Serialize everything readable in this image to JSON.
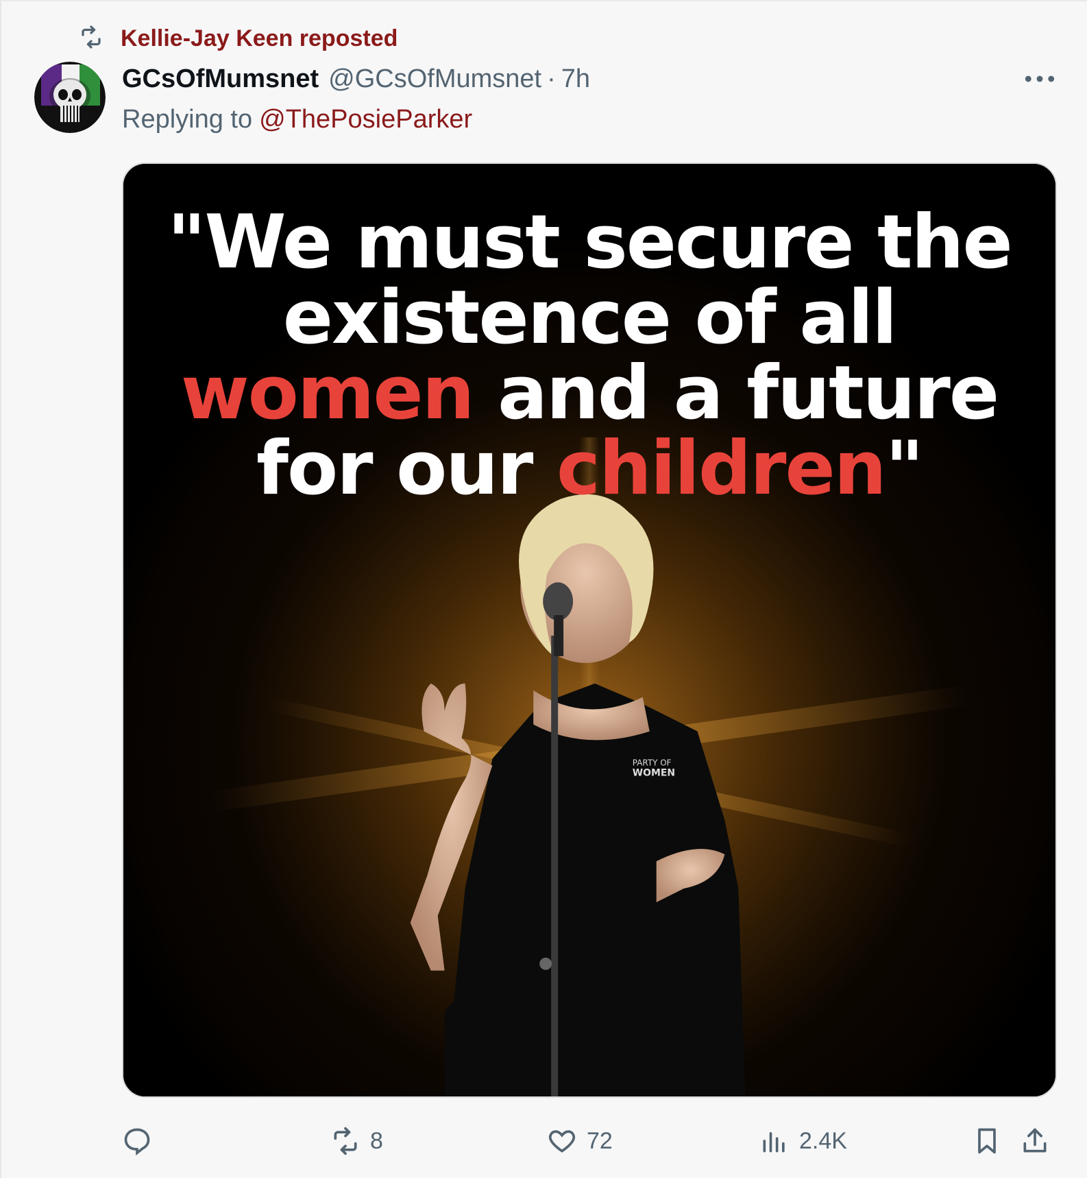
{
  "repost": {
    "label": "Kellie-Jay Keen reposted"
  },
  "author": {
    "display_name": "GCsOfMumsnet",
    "handle": "@GCsOfMumsnet",
    "separator": "·",
    "time": "7h"
  },
  "reply": {
    "prefix": "Replying to",
    "target": "@ThePosieParker"
  },
  "media": {
    "line1": "\"We must secure the",
    "line2": "existence of all",
    "line3_highlight": "women",
    "line3_rest": " and a future",
    "line4_start": "for our ",
    "line4_highlight": "children",
    "line4_end": "\"",
    "shirt_text": "PARTY OF WOMEN"
  },
  "actions": {
    "reply_icon": "reply-icon",
    "repost_count": "8",
    "like_count": "72",
    "views_count": "2.4K",
    "bookmark_icon": "bookmark-icon",
    "share_icon": "share-icon"
  },
  "colors": {
    "accent": "#8b1a1a",
    "highlight": "#e8433a",
    "muted": "#536471"
  }
}
